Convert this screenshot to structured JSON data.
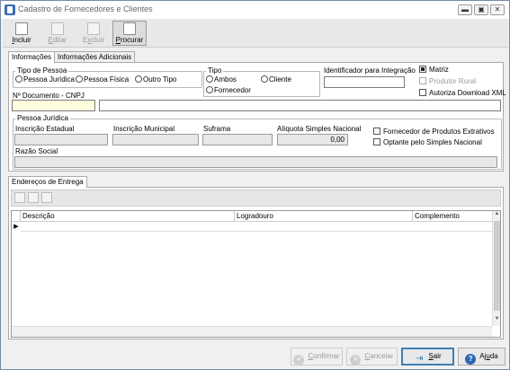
{
  "window": {
    "title": "Cadastro de Fornecedores e Clientes",
    "min_glyph": "▬",
    "max_glyph": "▣",
    "close_glyph": "✕"
  },
  "toolbar": {
    "incluir": {
      "pre": "",
      "accel": "I",
      "post": "ncluir"
    },
    "editar": {
      "pre": "",
      "accel": "E",
      "post": "ditar"
    },
    "excluir": {
      "pre": "E",
      "accel": "x",
      "post": "cluir"
    },
    "procurar": {
      "pre": "",
      "accel": "P",
      "post": "rocurar"
    }
  },
  "tabs": [
    {
      "label": "Informações"
    },
    {
      "label": "Informações Adicionais"
    }
  ],
  "tipo_pessoa": {
    "title": "Tipo de Pessoa",
    "options": [
      "Pessoa Jurídica",
      "Pessoa Física",
      "Outro Tipo"
    ]
  },
  "tipo": {
    "title": "Tipo",
    "options": [
      "Ambos",
      "Cliente",
      "Fornecedor"
    ]
  },
  "identificador": {
    "label": "Identificador para Integração",
    "value": ""
  },
  "checks": {
    "matriz": {
      "label": "Matriz",
      "checked": true
    },
    "produtor_rural": {
      "label": "Produtor Rural",
      "checked": false,
      "disabled": true
    },
    "autoriza_download": {
      "label": "Autoriza Download XML",
      "checked": false
    }
  },
  "documento": {
    "label": "Nº Documento - CNPJ",
    "value": "",
    "name_value": ""
  },
  "pessoa_juridica": {
    "title": "Pessoa Jurídica",
    "inscricao_estadual": {
      "label": "Inscrição Estadual",
      "value": ""
    },
    "inscricao_municipal": {
      "label": "Inscrição Municipal",
      "value": ""
    },
    "suframa": {
      "label": "Suframa",
      "value": ""
    },
    "aliquota": {
      "label": "Alíquota Simples Nacional",
      "value": "0,00"
    },
    "fornecedor_extrativos": {
      "label": "Fornecedor de Produtos Extrativos",
      "checked": false
    },
    "optante_simples": {
      "label": "Optante pelo Simples Nacional",
      "checked": false
    },
    "razao_social": {
      "label": "Razão Social",
      "value": ""
    }
  },
  "enderecos": {
    "tab": "Endereços de Entrega",
    "columns": [
      "Descrição",
      "Logradouro",
      "Complemento"
    ],
    "row_marker": "▶",
    "scroll_up": "▲",
    "scroll_down": "▼"
  },
  "buttons": {
    "confirmar": {
      "pre": "",
      "accel": "C",
      "post": "onfirmar",
      "icon": "✔"
    },
    "cancelar": {
      "pre": "",
      "accel": "C",
      "post": "ancelar",
      "icon": "✕"
    },
    "sair": {
      "pre": "",
      "accel": "S",
      "post": "air",
      "icon": "⇥"
    },
    "ajuda": {
      "pre": "Aj",
      "accel": "u",
      "post": "da",
      "icon": "?"
    }
  },
  "colors": {
    "accent": "#3c7fb1",
    "focus_field": "#ffffe0",
    "readonly_field": "#e8e8e8",
    "help_icon": "#2d64b8"
  }
}
